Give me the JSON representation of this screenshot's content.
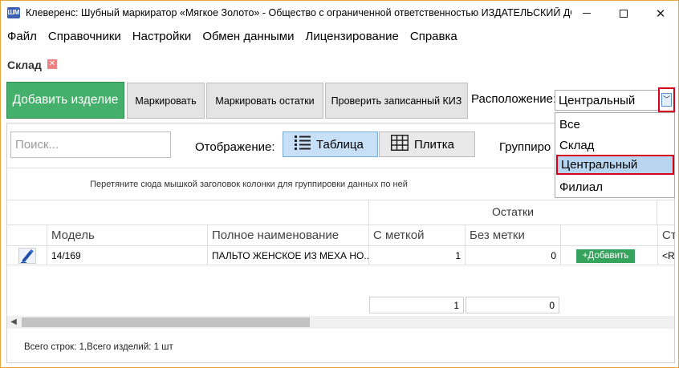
{
  "window": {
    "icon_label": "ШМ",
    "title": "Клеверенс: Шубный маркиратор «Мягкое Золото» - Общество с ограниченной ответственностью ИЗДАТЕЛЬСКИЙ ДОМ"
  },
  "menu": {
    "items": [
      "Файл",
      "Справочники",
      "Настройки",
      "Обмен данными",
      "Лицензирование",
      "Справка"
    ]
  },
  "section": {
    "title": "Склад",
    "close_glyph": "✕"
  },
  "toolbar": {
    "add_item": "Добавить изделие",
    "mark": "Маркировать",
    "mark_rest": "Маркировать остатки",
    "check_kiz": "Проверить записанный КИЗ",
    "location_label": "Расположение:",
    "location_value": "Центральный",
    "location_options": [
      "Все",
      "Склад",
      "Центральный",
      "Филиал"
    ]
  },
  "filters": {
    "search_placeholder": "Поиск...",
    "display_label": "Отображение:",
    "view_table": "Таблица",
    "view_tile": "Плитка",
    "group_label": "Группиро"
  },
  "grid": {
    "group_hint": "Перетяните сюда мышкой заголовок колонки для группировки данных по ней",
    "group_header": "Остатки",
    "columns": [
      "Модель",
      "Полное наименование",
      "С меткой",
      "Без метки",
      "Ст"
    ],
    "rows": [
      {
        "model": "14/169",
        "full_name": "ПАЛЬТО ЖЕНСКОЕ ИЗ МЕХА НО...",
        "with_tag": "1",
        "without_tag": "0",
        "add_label": "+Добавить",
        "truncated": "<R"
      }
    ],
    "totals": {
      "with_tag": "1",
      "without_tag": "0"
    }
  },
  "footer": {
    "summary": "Всего строк: 1,Всего изделий: 1 шт"
  }
}
